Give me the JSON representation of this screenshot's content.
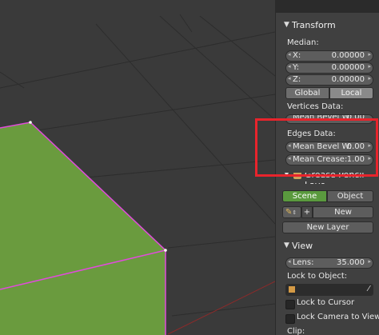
{
  "colors": {
    "face_green": "#6a9b3e",
    "edge_pink": "#e14bdc",
    "highlight_red": "#e8242c",
    "accent_green": "#5a9a3e",
    "accent_blue": "#5680c2"
  },
  "transform": {
    "title": "Transform",
    "median_label": "Median:",
    "x": {
      "label": "X:",
      "value": "0.00000"
    },
    "y": {
      "label": "Y:",
      "value": "0.00000"
    },
    "z": {
      "label": "Z:",
      "value": "0.00000"
    },
    "global": "Global",
    "local": "Local",
    "vertices_data_label": "Vertices Data:",
    "vertices_mean_bevel": {
      "label": "Mean Bevel W:",
      "value": "0.00"
    },
    "edges_data_label": "Edges Data:",
    "edges_mean_bevel": {
      "label": "Mean Bevel W:",
      "value": "0.00"
    },
    "mean_crease": {
      "label": "Mean Crease:",
      "value": "1.00"
    }
  },
  "grease_pencil": {
    "title": "Grease Pencil Laye",
    "scene": "Scene",
    "object": "Object",
    "plus": "+",
    "new": "New",
    "new_layer": "New Layer"
  },
  "view": {
    "title": "View",
    "lens": {
      "label": "Lens:",
      "value": "35.000"
    },
    "lock_to_object_label": "Lock to Object:",
    "lock_to_cursor": "Lock to Cursor",
    "lock_camera_to_view": "Lock Camera to View",
    "clip_label": "Clip:"
  }
}
